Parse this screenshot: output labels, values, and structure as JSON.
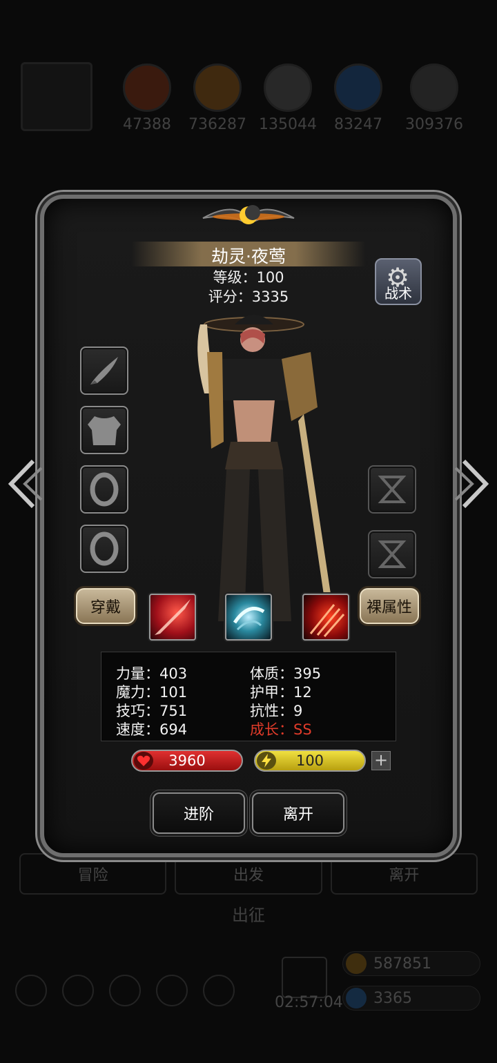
{
  "background": {
    "resources": [
      "47388",
      "736287",
      "135044",
      "83247",
      "309376"
    ],
    "tabs": [
      "冒险",
      "出发",
      "离开"
    ],
    "expedition_label": "出征",
    "timer": "02:57:04",
    "gold": "587851",
    "gems": "3365"
  },
  "hero": {
    "name": "劫灵·夜莺",
    "level_text": "等级：100",
    "score_text": "评分：3335"
  },
  "buttons": {
    "tactics": "战术",
    "wear": "穿戴",
    "base_attributes": "裸属性",
    "advance": "进阶",
    "leave": "离开"
  },
  "stats": {
    "strength": "力量：403",
    "constitution": "体质：395",
    "magic": "魔力：101",
    "armor": "护甲：12",
    "skill": "技巧：751",
    "resistance": "抗性：9",
    "speed": "速度：694",
    "growth": "成长：SS"
  },
  "bars": {
    "hp": "3960",
    "energy": "100",
    "plus": "+"
  },
  "colors": {
    "growth": "#e03b2a",
    "hp_bar": "#d02020",
    "energy_bar": "#e8d430"
  },
  "equipment_slots": [
    "blade-icon",
    "armor-icon",
    "ring-icon",
    "ring-icon"
  ],
  "accessory_slots": [
    "hourglass-icon",
    "hourglass-icon"
  ],
  "skills": [
    "crimson-slash-skill-icon",
    "frost-vortex-skill-icon",
    "blood-claw-skill-icon"
  ]
}
